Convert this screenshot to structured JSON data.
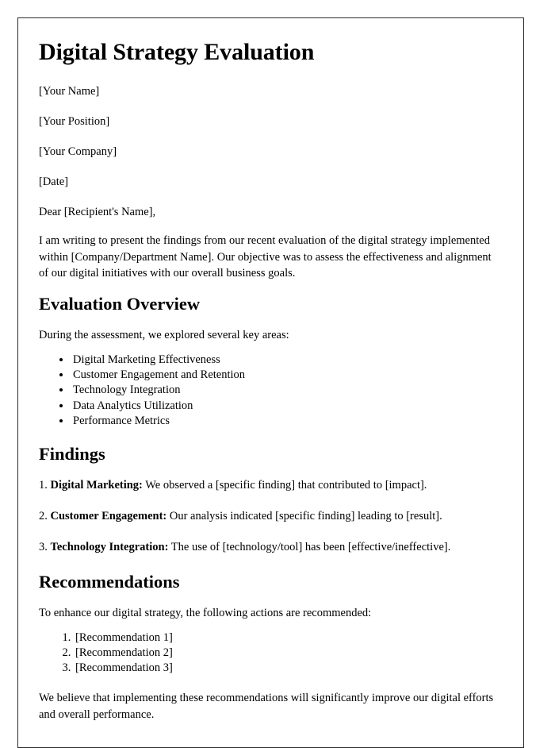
{
  "document": {
    "title": "Digital Strategy Evaluation",
    "header_fields": [
      "[Your Name]",
      "[Your Position]",
      "[Your Company]",
      "[Date]"
    ],
    "salutation": "Dear [Recipient's Name],",
    "intro_paragraph": "I am writing to present the findings from our recent evaluation of the digital strategy implemented within [Company/Department Name]. Our objective was to assess the effectiveness and alignment of our digital initiatives with our overall business goals.",
    "sections": {
      "evaluation_overview": {
        "heading": "Evaluation Overview",
        "lead": "During the assessment, we explored several key areas:",
        "bullets": [
          "Digital Marketing Effectiveness",
          "Customer Engagement and Retention",
          "Technology Integration",
          "Data Analytics Utilization",
          "Performance Metrics"
        ]
      },
      "findings": {
        "heading": "Findings",
        "items": [
          {
            "number": "1.",
            "label": "Digital Marketing:",
            "text": "We observed a [specific finding] that contributed to [impact]."
          },
          {
            "number": "2.",
            "label": "Customer Engagement:",
            "text": "Our analysis indicated [specific finding] leading to [result]."
          },
          {
            "number": "3.",
            "label": "Technology Integration:",
            "text": "The use of [technology/tool] has been [effective/ineffective]."
          }
        ]
      },
      "recommendations": {
        "heading": "Recommendations",
        "lead": "To enhance our digital strategy, the following actions are recommended:",
        "items": [
          "[Recommendation 1]",
          "[Recommendation 2]",
          "[Recommendation 3]"
        ],
        "closing": "We believe that implementing these recommendations will significantly improve our digital efforts and overall performance."
      }
    }
  },
  "style": {
    "page_border_color": "#2b2b2b",
    "page_background": "#ffffff",
    "text_color": "#000000"
  }
}
